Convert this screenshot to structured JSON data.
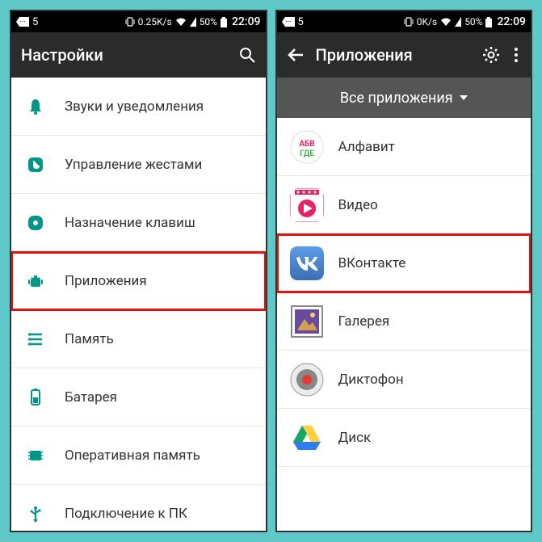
{
  "left": {
    "statusbar": {
      "notif_count": "5",
      "data_rate": "0.25K/s",
      "battery_pct": "50%",
      "clock": "22:09"
    },
    "appbar": {
      "title": "Настройки"
    },
    "items": [
      {
        "icon": "bell",
        "label": "Звуки и уведомления",
        "highlight": false
      },
      {
        "icon": "gesture",
        "label": "Управление жестами",
        "highlight": false
      },
      {
        "icon": "key-assign",
        "label": "Назначение клавиш",
        "highlight": false
      },
      {
        "icon": "android",
        "label": "Приложения",
        "highlight": true
      },
      {
        "icon": "memory",
        "label": "Память",
        "highlight": false
      },
      {
        "icon": "battery",
        "label": "Батарея",
        "highlight": false
      },
      {
        "icon": "ram",
        "label": "Оперативная память",
        "highlight": false
      },
      {
        "icon": "usb",
        "label": "Подключение к ПК",
        "highlight": false
      }
    ]
  },
  "right": {
    "statusbar": {
      "notif_count": "5",
      "data_rate": "0K/s",
      "battery_pct": "50%",
      "clock": "22:09"
    },
    "appbar": {
      "title": "Приложения"
    },
    "dropdown": "Все приложения",
    "apps": [
      {
        "icon": "alphabet",
        "label": "Алфавит",
        "highlight": false
      },
      {
        "icon": "video",
        "label": "Видео",
        "highlight": false
      },
      {
        "icon": "vk",
        "label": "ВКонтакте",
        "highlight": true
      },
      {
        "icon": "gallery",
        "label": "Галерея",
        "highlight": false
      },
      {
        "icon": "recorder",
        "label": "Диктофон",
        "highlight": false
      },
      {
        "icon": "drive",
        "label": "Диск",
        "highlight": false
      }
    ]
  },
  "colors": {
    "teal": "#009688",
    "highlight": "#e2130d",
    "appbar": "#2b2b2b",
    "dropdown": "#555555"
  }
}
